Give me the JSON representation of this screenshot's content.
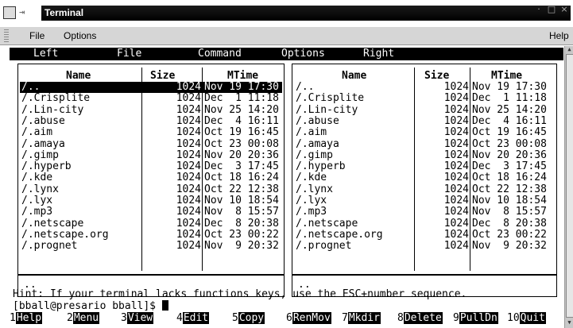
{
  "window": {
    "title": "Terminal"
  },
  "menubar": {
    "file": "File",
    "options": "Options",
    "help": "Help"
  },
  "mc_menu": [
    "Left",
    "File",
    "Command",
    "Options",
    "Right"
  ],
  "panels": {
    "headers": {
      "name": "Name",
      "size": "Size",
      "mtime": "MTime"
    },
    "rows": [
      {
        "name": "/..",
        "size": "1024",
        "time": "Nov 19 17:30"
      },
      {
        "name": "/.Crisplite",
        "size": "1024",
        "time": "Dec  1 11:18"
      },
      {
        "name": "/.Lin-city",
        "size": "1024",
        "time": "Nov 25 14:20"
      },
      {
        "name": "/.abuse",
        "size": "1024",
        "time": "Dec  4 16:11"
      },
      {
        "name": "/.aim",
        "size": "1024",
        "time": "Oct 19 16:45"
      },
      {
        "name": "/.amaya",
        "size": "1024",
        "time": "Oct 23 00:08"
      },
      {
        "name": "/.gimp",
        "size": "1024",
        "time": "Nov 20 20:36"
      },
      {
        "name": "/.hyperb",
        "size": "1024",
        "time": "Dec  3 17:45"
      },
      {
        "name": "/.kde",
        "size": "1024",
        "time": "Oct 18 16:24"
      },
      {
        "name": "/.lynx",
        "size": "1024",
        "time": "Oct 22 12:38"
      },
      {
        "name": "/.lyx",
        "size": "1024",
        "time": "Nov 10 18:54"
      },
      {
        "name": "/.mp3",
        "size": "1024",
        "time": "Nov  8 15:57"
      },
      {
        "name": "/.netscape",
        "size": "1024",
        "time": "Dec  8 20:38"
      },
      {
        "name": "/.netscape.org",
        "size": "1024",
        "time": "Oct 23 00:22"
      },
      {
        "name": "/.prognet",
        "size": "1024",
        "time": "Nov  9 20:32"
      }
    ],
    "mini_status": ".."
  },
  "hint": "Hint: If your terminal lacks functions keys, use the ESC+number sequence.",
  "prompt": "[bball@presario bball]$ ",
  "fkeys": [
    {
      "n": "1",
      "label": "Help"
    },
    {
      "n": "2",
      "label": "Menu"
    },
    {
      "n": "3",
      "label": "View"
    },
    {
      "n": "4",
      "label": "Edit"
    },
    {
      "n": "5",
      "label": "Copy"
    },
    {
      "n": "6",
      "label": "RenMov"
    },
    {
      "n": "7",
      "label": "Mkdir"
    },
    {
      "n": "8",
      "label": "Delete"
    },
    {
      "n": "9",
      "label": "PullDn"
    },
    {
      "n": "10",
      "label": "Quit"
    }
  ]
}
